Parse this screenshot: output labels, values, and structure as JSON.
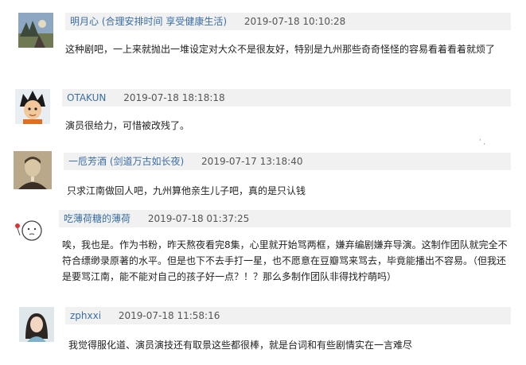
{
  "comments": [
    {
      "user": "明月心",
      "signature": "(合理安排时间 享受健康生活)",
      "time": "2019-07-18 10:10:28",
      "text": "这种剧吧，一上来就抛出一堆设定对大众不是很友好，特别是九州那些奇奇怪怪的容易看着看着就烦了",
      "avatar": "landscape-avatar"
    },
    {
      "user": "OTAKUN",
      "signature": "",
      "time": "2019-07-18 18:18:18",
      "text": "演员很给力，可惜被改残了。",
      "avatar": "cartoon-avatar"
    },
    {
      "user": "一卮芳酒",
      "signature": "(剑道万古如长夜)",
      "time": "2019-07-17 13:18:40",
      "text": "只求江南做回人吧，九州算他亲生儿子吧，真的是只认钱",
      "avatar": "portrait-avatar"
    },
    {
      "user": "吃薄荷糖的薄荷",
      "signature": "",
      "time": "2019-07-18 01:37:25",
      "text": "唉，我也是。作为书粉，昨天熬夜看完8集，心里就开始骂两框，嫌弃编剧嫌弃导演。这制作团队就完全不符合缥缈录原著的水平。但是也下不去手打一星，也不愿意在豆瓣骂来骂去，毕竟能播出不容易。（但我还是要骂江南，能不能对自己的孩子好一点？！？那么多制作团队非得找柠萌吗）",
      "avatar": "doodle-avatar"
    },
    {
      "user": "zphxxi",
      "signature": "",
      "time": "2019-07-18 11:58:16",
      "text": "我觉得服化道、演员演技还有取景这些都很棒，就是台词和有些剧情实在一言难尽",
      "avatar": "girl-avatar"
    }
  ],
  "corner_mark": "' ,"
}
